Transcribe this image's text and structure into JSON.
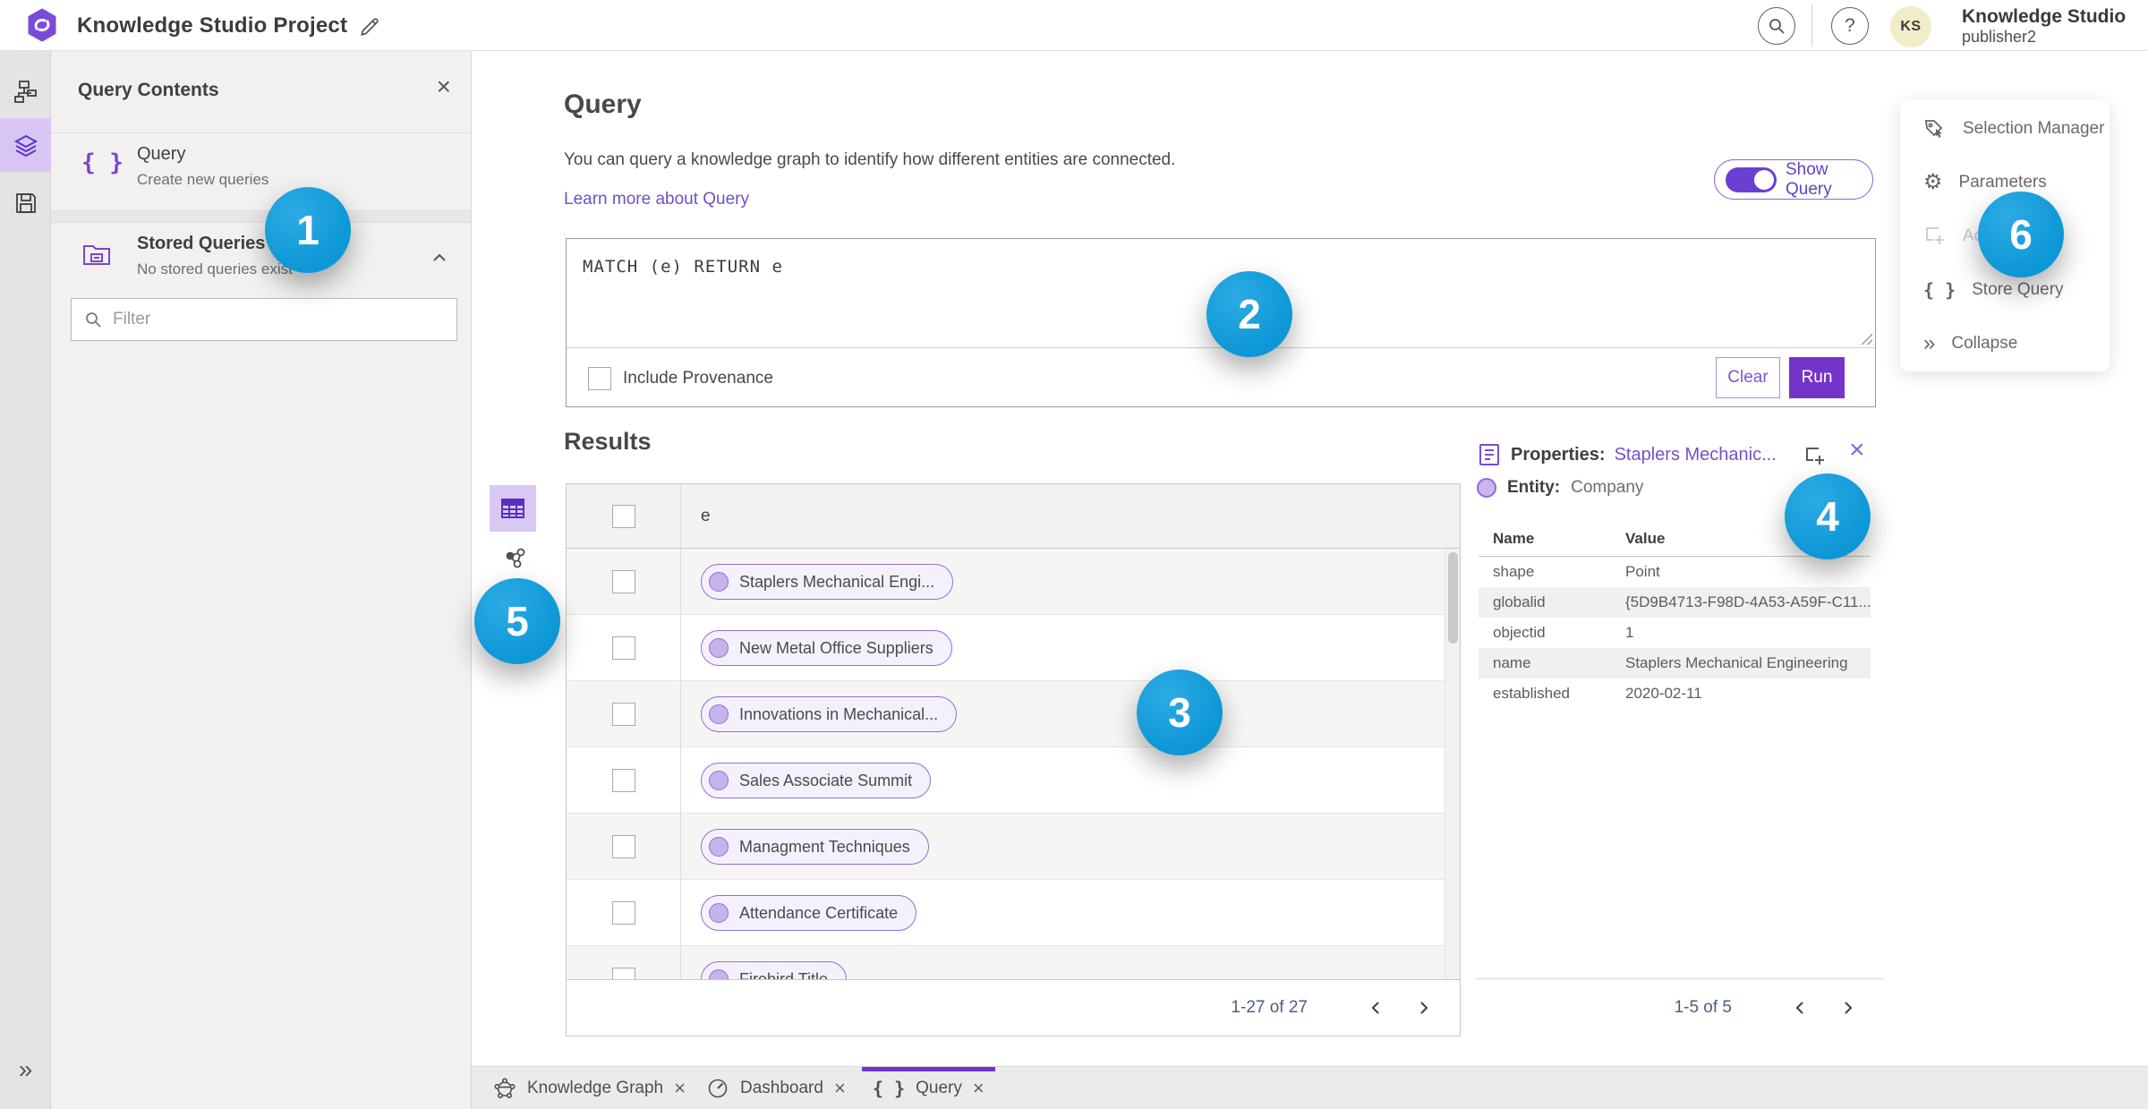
{
  "header": {
    "app_title": "Knowledge Studio Project",
    "user_name": "Knowledge Studio",
    "user_role": "publisher2",
    "avatar_initials": "KS"
  },
  "icons": {
    "close": "×",
    "help": "?",
    "braces": "{ }",
    "gear": "⚙",
    "collapse": "»"
  },
  "contents_panel": {
    "title": "Query Contents",
    "query_item": {
      "label": "Query",
      "description": "Create new queries"
    },
    "stored_item": {
      "label": "Stored Queries",
      "description": "No stored queries exist"
    },
    "filter_placeholder": "Filter"
  },
  "query_section": {
    "title": "Query",
    "description": "You can query a knowledge graph to identify how different entities are connected.",
    "learn_more": "Learn more about Query",
    "show_query_label": "Show Query",
    "editor_text": "MATCH (e) RETURN e",
    "include_provenance_label": "Include Provenance",
    "clear_label": "Clear",
    "run_label": "Run"
  },
  "results": {
    "title": "Results",
    "column_header": "e",
    "rows": [
      "Staplers Mechanical Engi...",
      "New Metal Office Suppliers",
      "Innovations in Mechanical...",
      "Sales Associate Summit",
      "Managment Techniques",
      "Attendance Certificate",
      "Firebird Title"
    ],
    "pagination_range": "1-27 of 27"
  },
  "properties_panel": {
    "label": "Properties:",
    "link": "Staplers Mechanic...",
    "entity_label": "Entity:",
    "entity_value": "Company",
    "col_name": "Name",
    "col_value": "Value",
    "rows": [
      {
        "name": "shape",
        "value": "Point"
      },
      {
        "name": "globalid",
        "value": "{5D9B4713-F98D-4A53-A59F-C11..."
      },
      {
        "name": "objectid",
        "value": "1"
      },
      {
        "name": "name",
        "value": "Staplers Mechanical Engineering"
      },
      {
        "name": "established",
        "value": "2020-02-11"
      }
    ],
    "pagination_range": "1-5 of 5"
  },
  "right_menu": {
    "items": [
      {
        "label": "Selection Manager"
      },
      {
        "label": "Parameters"
      },
      {
        "label": "Ad"
      },
      {
        "label": "Store Query"
      },
      {
        "label": "Collapse"
      }
    ]
  },
  "bottom_tabs": [
    {
      "label": "Knowledge Graph"
    },
    {
      "label": "Dashboard"
    },
    {
      "label": "Query"
    }
  ],
  "badges": [
    "1",
    "2",
    "3",
    "4",
    "5",
    "6"
  ],
  "colors": {
    "accent_purple": "#7434ce",
    "badge_blue": "#0d97d6",
    "chip_border": "#8f6ed9"
  }
}
